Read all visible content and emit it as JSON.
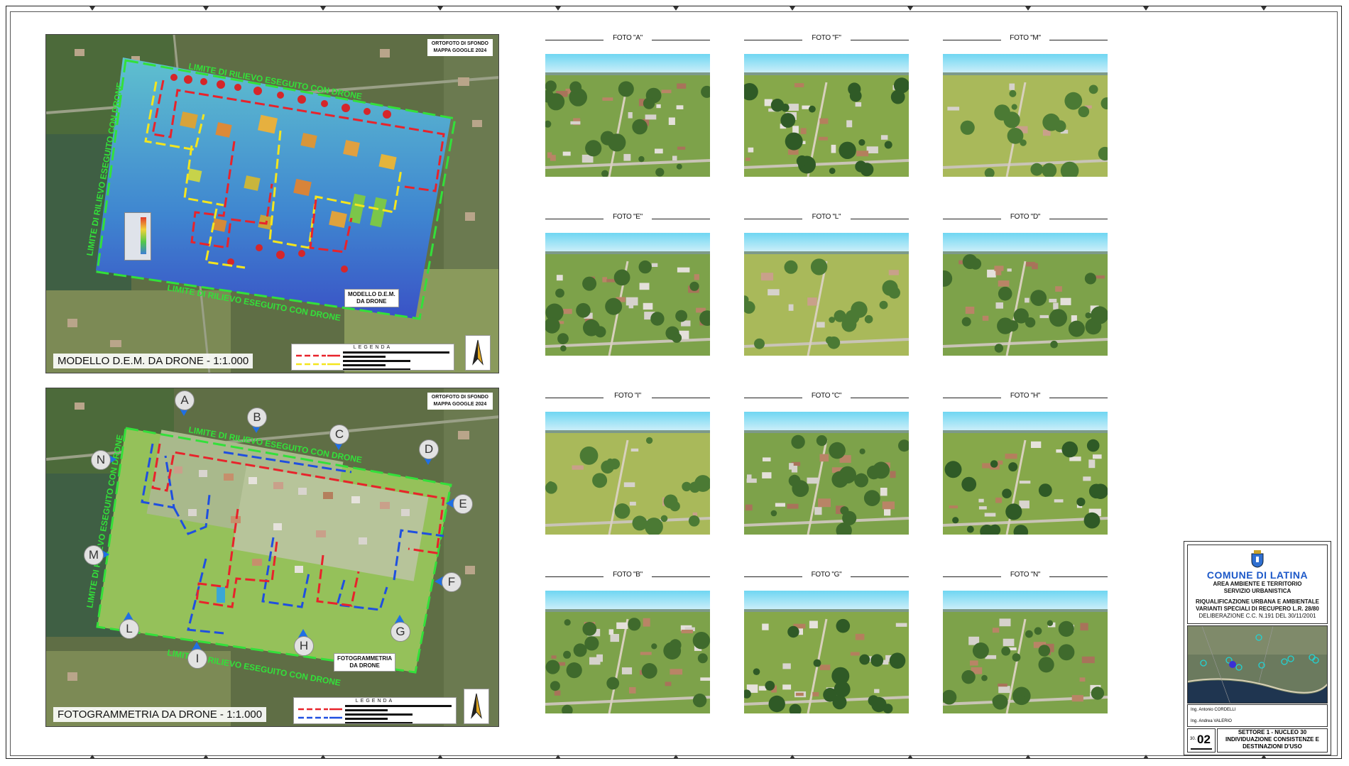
{
  "top_map": {
    "source_line1": "ORTOFOTO DI SFONDO",
    "source_line2": "MAPPA GOOGLE 2024",
    "title": "MODELLO D.E.M. DA DRONE - 1:1.000",
    "inner_label_line1": "MODELLO D.E.M.",
    "inner_label_line2": "DA DRONE",
    "boundary_label": "LIMITE DI RILIEVO ESEGUITO CON DRONE",
    "legend_title": "LEGENDA",
    "legend_colors": [
      "#e8232b",
      "#f4e51e"
    ]
  },
  "bottom_map": {
    "source_line1": "ORTOFOTO DI SFONDO",
    "source_line2": "MAPPA GOOGLE 2024",
    "title": "FOTOGRAMMETRIA DA DRONE - 1:1.000",
    "inner_label_line1": "FOTOGRAMMETRIA",
    "inner_label_line2": "DA DRONE",
    "boundary_label": "LIMITE DI RILIEVO ESEGUITO CON DRONE",
    "legend_title": "LEGENDA",
    "legend_colors": [
      "#e8232b",
      "#1f4fe0"
    ],
    "viewpoints": [
      "A",
      "B",
      "C",
      "D",
      "E",
      "F",
      "G",
      "H",
      "I",
      "L",
      "M",
      "N"
    ]
  },
  "photos": [
    {
      "label": "FOTO \"A\"",
      "palette": "town"
    },
    {
      "label": "FOTO \"E\"",
      "palette": "town"
    },
    {
      "label": "FOTO \"I\"",
      "palette": "field"
    },
    {
      "label": "FOTO \"B\"",
      "palette": "town"
    },
    {
      "label": "FOTO \"F\"",
      "palette": "trees"
    },
    {
      "label": "FOTO \"L\"",
      "palette": "field"
    },
    {
      "label": "FOTO \"C\"",
      "palette": "town"
    },
    {
      "label": "FOTO \"G\"",
      "palette": "trees"
    },
    {
      "label": "FOTO \"M\"",
      "palette": "field"
    },
    {
      "label": "FOTO \"D\"",
      "palette": "town"
    },
    {
      "label": "FOTO \"H\"",
      "palette": "trees"
    },
    {
      "label": "FOTO \"N\"",
      "palette": "town"
    }
  ],
  "title_block": {
    "city": "COMUNE DI LATINA",
    "dept1": "AREA AMBIENTE E TERRITORIO",
    "dept2": "SERVIZIO URBANISTICA",
    "project1": "RIQUALIFICAZIONE URBANA E AMBIENTALE",
    "project2": "VARIANTI SPECIALI DI RECUPERO L.R. 28/80",
    "deliberation": "DELIBERAZIONE C.C. N.191 DEL 30/11/2001",
    "signer1": "Ing. Antonio CORDELLI",
    "signer2": "Ing. Andrea VALERIO",
    "sheet_prefix": "30.",
    "sheet_number": "02",
    "sector": "SETTORE 1 - NUCLEO 30",
    "desc1": "INDIVIDUAZIONE CONSISTENZE E",
    "desc2": "DESTINAZIONI D'USO",
    "accent_color": "#1c58c8"
  }
}
